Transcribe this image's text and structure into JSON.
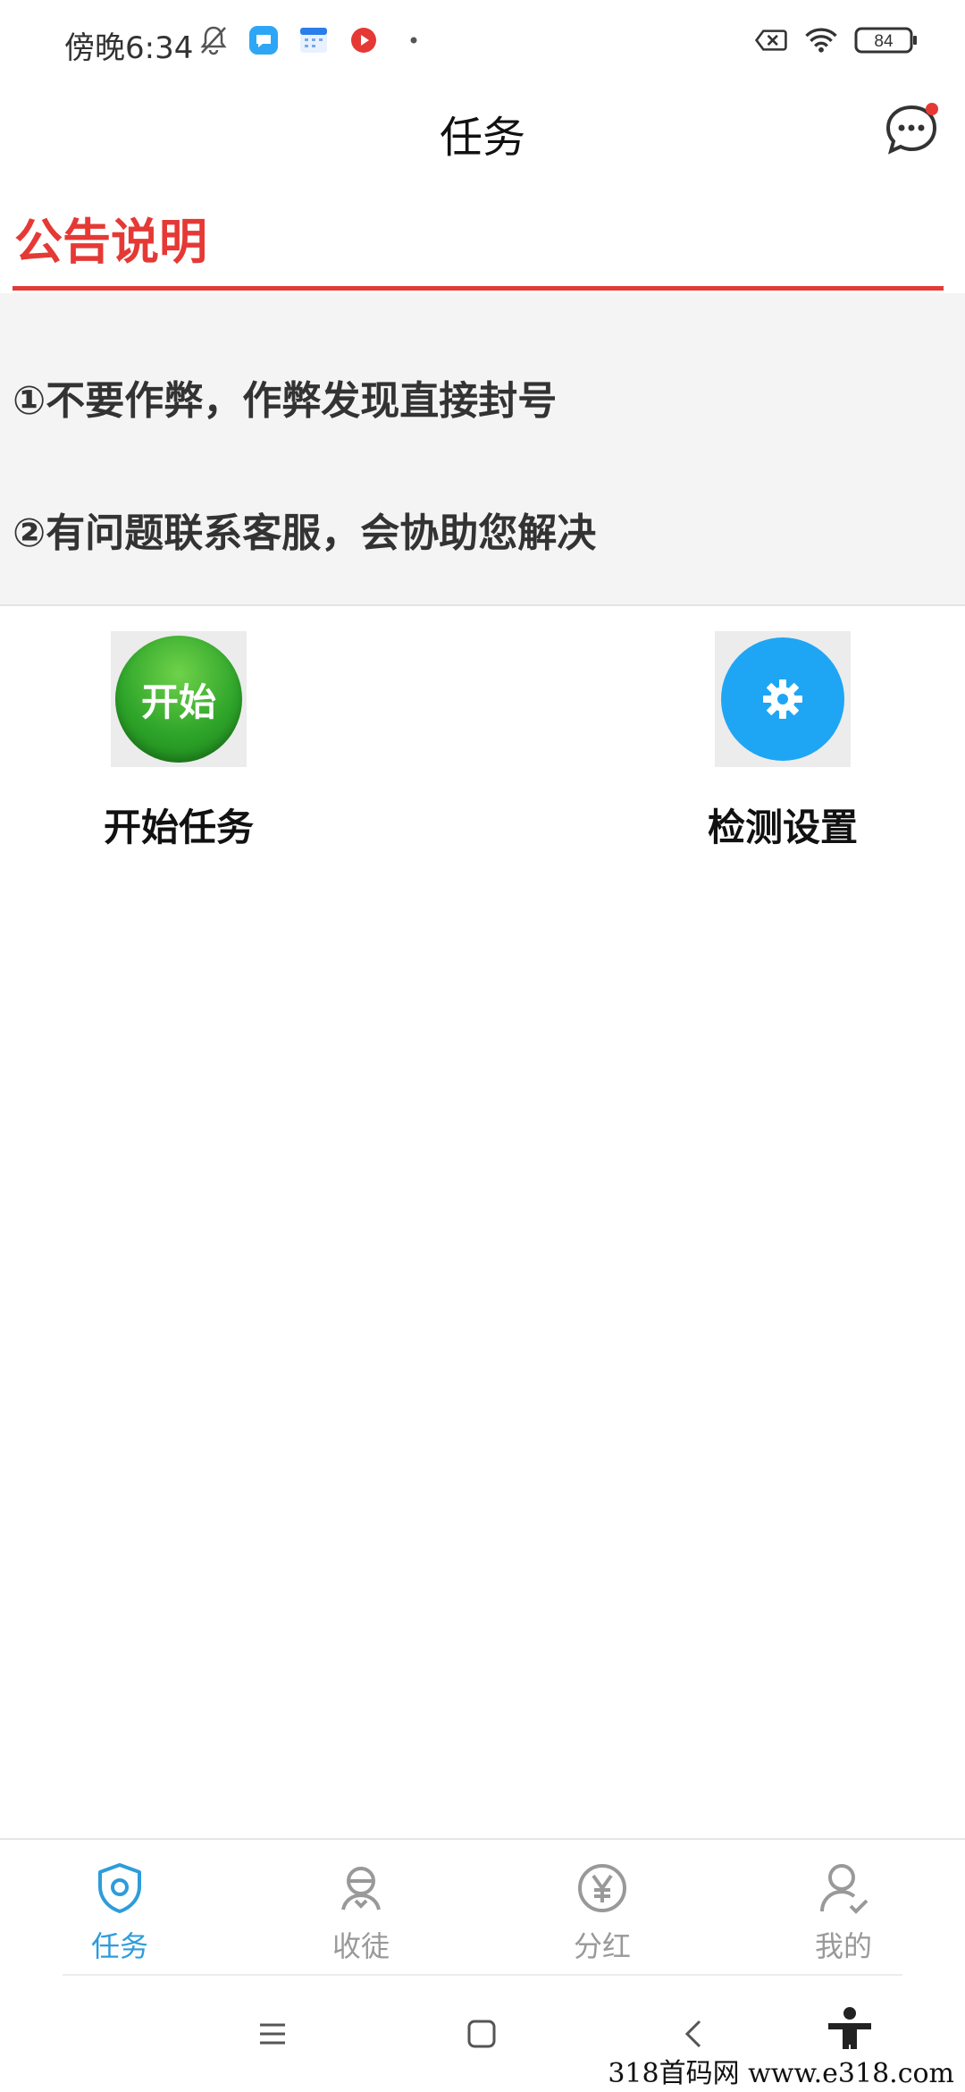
{
  "status_bar": {
    "time": "傍晚6:34",
    "battery": "84",
    "icons_left": [
      "bell-off-icon",
      "chat-app-icon",
      "calendar-app-icon",
      "video-app-icon",
      "dot-icon"
    ],
    "icons_right": [
      "sim-off-icon",
      "wifi-icon",
      "battery-icon"
    ]
  },
  "header": {
    "title": "任务",
    "message_icon": "chat-bubble-icon",
    "has_unread": true
  },
  "notice": {
    "title": "公告说明",
    "items": [
      "①不要作弊，作弊发现直接封号",
      "②有问题联系客服，会协助您解决"
    ]
  },
  "actions": {
    "start": {
      "icon_text": "开始",
      "label": "开始任务"
    },
    "settings": {
      "label": "检测设置",
      "icon": "gear-icon"
    }
  },
  "tabs": [
    {
      "label": "任务",
      "icon": "shield-icon",
      "active": true
    },
    {
      "label": "收徒",
      "icon": "apprentice-icon",
      "active": false
    },
    {
      "label": "分红",
      "icon": "yen-icon",
      "active": false
    },
    {
      "label": "我的",
      "icon": "user-check-icon",
      "active": false
    }
  ],
  "system_nav": [
    "menu-icon",
    "home-icon",
    "back-icon",
    "accessibility-icon"
  ],
  "watermark": "318首码网 www.e318.com",
  "colors": {
    "accent_red": "#e53935",
    "active_tab": "#2d9cdb",
    "inactive_tab": "#999999",
    "settings_blue": "#1ea6f4",
    "start_green": "#2fa52a"
  }
}
